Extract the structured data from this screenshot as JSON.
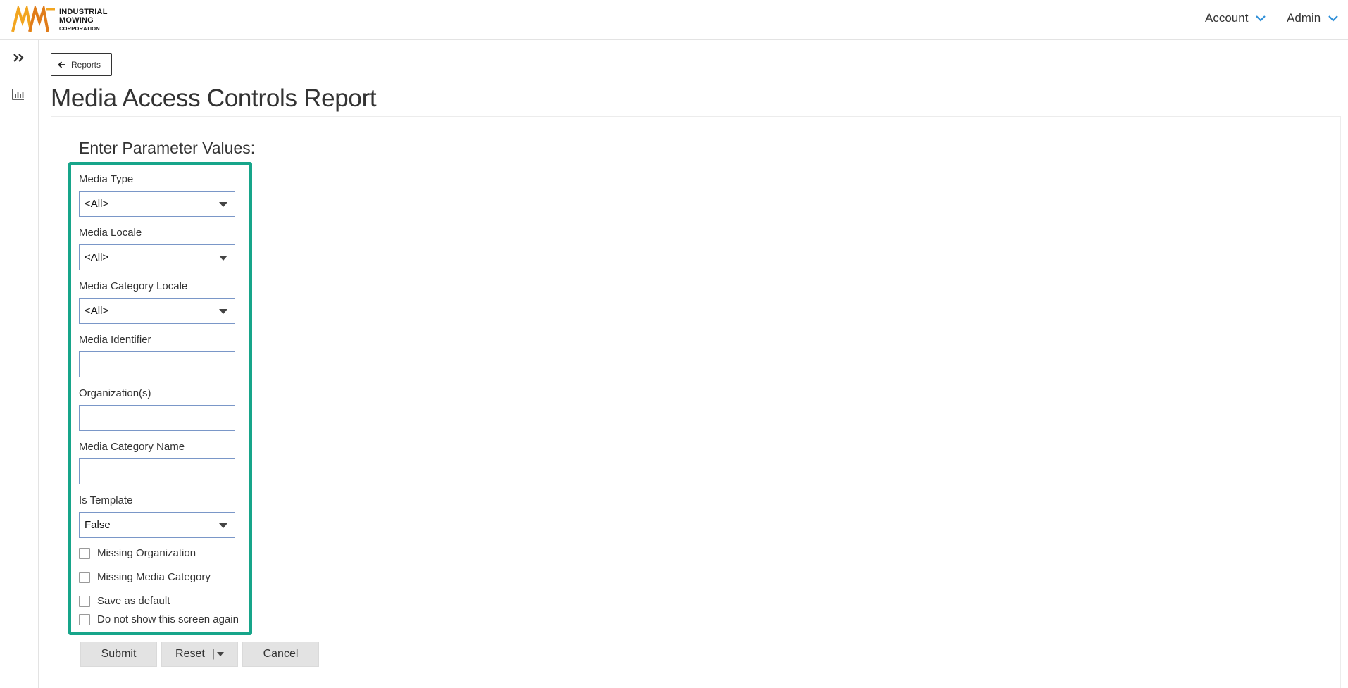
{
  "brand": {
    "line1": "INDUSTRIAL",
    "line2": "MOWING",
    "line3": "CORPORATION",
    "logo_colors": [
      "#f2a51f",
      "#e07c1a"
    ]
  },
  "header": {
    "account_label": "Account",
    "admin_label": "Admin",
    "chevron_color": "#2f8fd8"
  },
  "sidebar": {
    "items": [
      {
        "icon": "double-chevron-right-icon"
      },
      {
        "icon": "bar-chart-icon"
      }
    ]
  },
  "back_button": {
    "label": "Reports",
    "icon": "arrow-left-icon"
  },
  "page": {
    "title": "Media Access Controls Report"
  },
  "form": {
    "heading": "Enter Parameter Values:",
    "highlight_color": "#17a58a",
    "fields": {
      "media_type": {
        "label": "Media Type",
        "value": "<All>"
      },
      "media_locale": {
        "label": "Media Locale",
        "value": "<All>"
      },
      "media_category_locale": {
        "label": "Media Category Locale",
        "value": "<All>"
      },
      "media_identifier": {
        "label": "Media Identifier",
        "value": ""
      },
      "organizations": {
        "label": "Organization(s)",
        "value": ""
      },
      "media_category_name": {
        "label": "Media Category Name",
        "value": ""
      },
      "is_template": {
        "label": "Is Template",
        "value": "False"
      }
    },
    "checkboxes": {
      "missing_organization": {
        "label": "Missing Organization",
        "checked": false
      },
      "missing_media_category": {
        "label": "Missing Media Category",
        "checked": false
      },
      "save_as_default": {
        "label": "Save as default",
        "checked": false
      },
      "do_not_show": {
        "label": "Do not show this screen again",
        "checked": false
      }
    },
    "buttons": {
      "submit": "Submit",
      "reset": "Reset",
      "reset_separator": "|",
      "cancel": "Cancel"
    }
  }
}
